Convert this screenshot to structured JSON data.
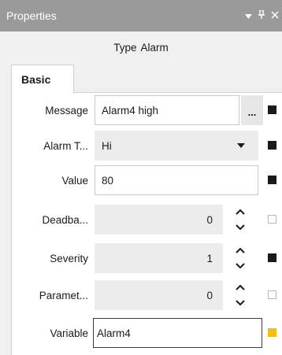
{
  "panel": {
    "title": "Properties",
    "pin_glyph": "▾ ⊥",
    "close_glyph": "✕"
  },
  "type_line": {
    "label": "Type",
    "value": "Alarm"
  },
  "tabs": [
    {
      "label": "Basic",
      "active": true
    }
  ],
  "properties": [
    {
      "label": "Message",
      "value": "Alarm4 high",
      "control": "text-ellipsis",
      "marker": "filled"
    },
    {
      "label": "Alarm T...",
      "value": "Hi",
      "control": "dropdown",
      "marker": "filled"
    },
    {
      "label": "Value",
      "value": "80",
      "control": "text",
      "marker": "filled"
    },
    {
      "label": "Deadba...",
      "value": "0",
      "control": "spinner",
      "marker": "empty"
    },
    {
      "label": "Severity",
      "value": "1",
      "control": "spinner",
      "marker": "filled"
    },
    {
      "label": "Paramet...",
      "value": "0",
      "control": "spinner",
      "marker": "empty"
    },
    {
      "label": "Variable",
      "value": "Alarm4",
      "control": "text-active",
      "marker": "yellow"
    }
  ],
  "ellipsis_label": "...",
  "icons": {
    "menu": "chevron-down-icon",
    "pin": "pin-icon",
    "close": "close-icon",
    "dropdown": "chevron-down-icon",
    "spinner": "spinner-icon"
  },
  "colors": {
    "titlebar_bg": "#9a9a9a",
    "marker_set": "#1a1a1a",
    "marker_binding": "#f2c00f"
  }
}
